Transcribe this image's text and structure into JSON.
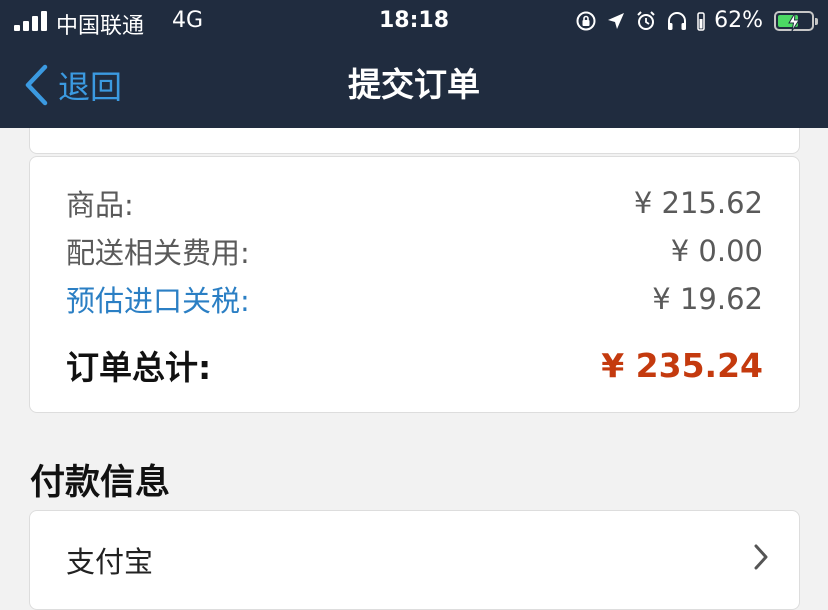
{
  "status_bar": {
    "carrier": "中国联通",
    "network": "4G",
    "time": "18:18",
    "battery_percent": "62%",
    "battery_level": 0.62
  },
  "nav": {
    "back_label": "退回",
    "title": "提交订单"
  },
  "summary": {
    "items_label": "商品:",
    "items_value": "¥ 215.62",
    "shipping_label": "配送相关费用:",
    "shipping_value": "¥ 0.00",
    "tax_label": "预估进口关税:",
    "tax_value": "¥ 19.62",
    "total_label": "订单总计:",
    "total_value": "¥ 235.24"
  },
  "payment": {
    "section_title": "付款信息",
    "method_label": "支付宝"
  },
  "colors": {
    "header_bg": "#202c3f",
    "accent_blue": "#3b9ae1",
    "link_blue": "#2b7fc4",
    "total_red": "#c43a0e",
    "battery_green": "#4cd964"
  }
}
